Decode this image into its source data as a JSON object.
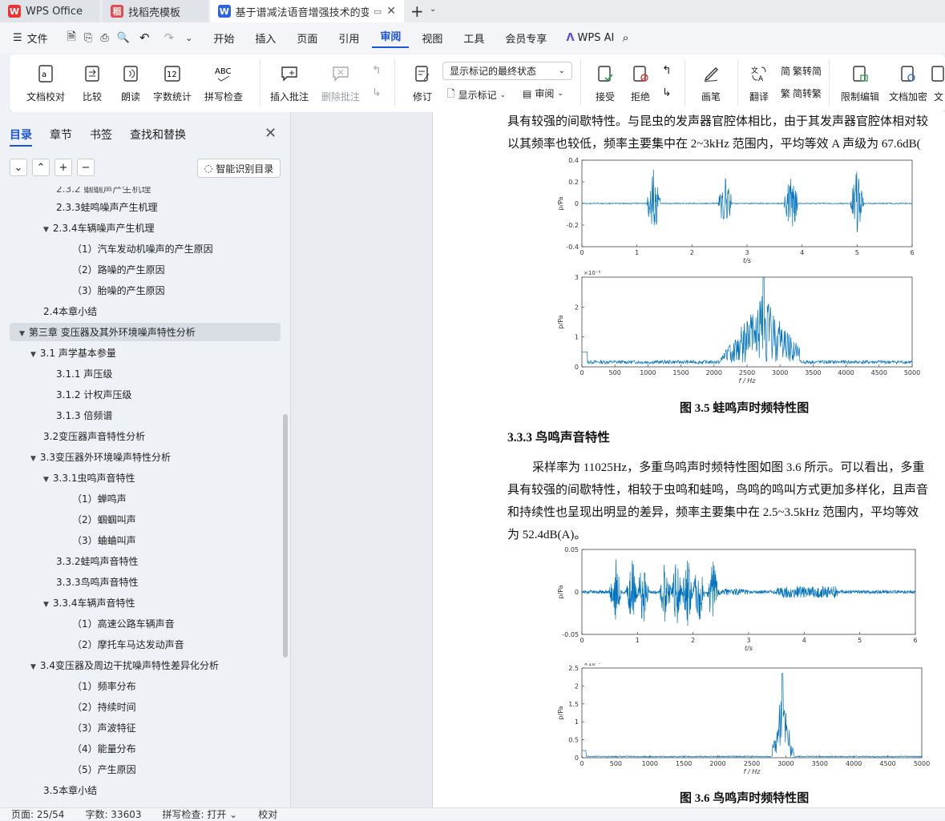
{
  "tabs": [
    {
      "label": "WPS Office",
      "icon": "wps-logo-icon"
    },
    {
      "label": "找稻壳模板",
      "icon": "docer-icon"
    },
    {
      "label": "基于谱减法语音增强技术的变压",
      "icon": "word-doc-icon"
    }
  ],
  "menu": {
    "file": "文件",
    "items": [
      "开始",
      "插入",
      "页面",
      "引用",
      "审阅",
      "视图",
      "工具",
      "会员专享"
    ],
    "active": "审阅",
    "ai": "WPS AI"
  },
  "ribbon": {
    "buttons": [
      "文档校对",
      "比较",
      "朗读",
      "字数统计",
      "拼写检查",
      "插入批注",
      "删除批注",
      "修订",
      "显示标记",
      "审阅",
      "接受",
      "拒绝",
      "画笔",
      "翻译",
      "繁转简",
      "简转繁",
      "限制编辑",
      "文档加密",
      "文"
    ],
    "markup_select": "显示标记的最终状态"
  },
  "sidebar": {
    "tabs": [
      "目录",
      "章节",
      "书签",
      "查找和替换"
    ],
    "smart_button": "智能识别目录",
    "toc": [
      {
        "text": "2.3.3蛙鸣噪声产生机理",
        "level": 2,
        "caret": false
      },
      {
        "text": "2.3.4车辆噪声产生机理",
        "level": 2,
        "caret": true
      },
      {
        "text": "（1）汽车发动机噪声的产生原因",
        "level": 3,
        "caret": false
      },
      {
        "text": "（2）路噪的产生原因",
        "level": 3,
        "caret": false
      },
      {
        "text": "（3）胎噪的产生原因",
        "level": 3,
        "caret": false
      },
      {
        "text": "2.4本章小结",
        "level": 1,
        "caret": false
      },
      {
        "text": "第三章  变压器及其外环境噪声特性分析",
        "level": 0,
        "caret": true,
        "highlight": true
      },
      {
        "text": "3.1  声学基本参量",
        "level": 1,
        "caret": true
      },
      {
        "text": "3.1.1  声压级",
        "level": 2,
        "caret": false
      },
      {
        "text": "3.1.2  计权声压级",
        "level": 2,
        "caret": false
      },
      {
        "text": "3.1.3  倍频谱",
        "level": 2,
        "caret": false
      },
      {
        "text": "3.2变压器声音特性分析",
        "level": 1,
        "caret": false
      },
      {
        "text": "3.3变压器外环境噪声特性分析",
        "level": 1,
        "caret": true
      },
      {
        "text": "3.3.1虫鸣声音特性",
        "level": 2,
        "caret": true
      },
      {
        "text": "（1）蝉鸣声",
        "level": 3,
        "caret": false
      },
      {
        "text": "（2）蝈蝈叫声",
        "level": 3,
        "caret": false
      },
      {
        "text": "（3）蛐蛐叫声",
        "level": 3,
        "caret": false
      },
      {
        "text": "3.3.2蛙鸣声音特性",
        "level": 2,
        "caret": false
      },
      {
        "text": "3.3.3鸟鸣声音特性",
        "level": 2,
        "caret": false
      },
      {
        "text": "3.3.4车辆声音特性",
        "level": 2,
        "caret": true
      },
      {
        "text": "（1）高速公路车辆声音",
        "level": 3,
        "caret": false
      },
      {
        "text": "（2）摩托车马达发动声音",
        "level": 3,
        "caret": false
      },
      {
        "text": "3.4变压器及周边干扰噪声特性差异化分析",
        "level": 1,
        "caret": true
      },
      {
        "text": "（1）频率分布",
        "level": 3,
        "caret": false
      },
      {
        "text": "（2）持续时间",
        "level": 3,
        "caret": false
      },
      {
        "text": "（3）声波特征",
        "level": 3,
        "caret": false
      },
      {
        "text": "（4）能量分布",
        "level": 3,
        "caret": false
      },
      {
        "text": "（5）产生原因",
        "level": 3,
        "caret": false
      },
      {
        "text": "3.5本章小结",
        "level": 1,
        "caret": false
      }
    ]
  },
  "document": {
    "para_top_1": "具有较强的间歇特性。与昆虫的发声器官腔体相比，由于其发声器官腔体相对较",
    "para_top_2": "以其频率也较低，频率主要集中在 2~3kHz 范围内，平均等效 A 声级为 67.6dB(",
    "fig35_caption": "图 3.5  蛙鸣声时频特性图",
    "section_heading": "3.3.3  鸟鸣声音特性",
    "para_bird_1": "采样率为 11025Hz，多重鸟鸣声时频特性图如图 3.6 所示。可以看出，多重",
    "para_bird_2": "具有较强的间歇特性，相较于虫鸣和蛙鸣，鸟鸣的鸣叫方式更加多样化，且声音",
    "para_bird_3": "和持续性也呈现出明显的差异，频率主要集中在 2.5~3.5kHz 范围内，平均等效",
    "para_bird_4": "为 52.4dB(A)。",
    "fig36_caption": "图 3.6  鸟鸣声时频特性图"
  },
  "chart_data": [
    {
      "type": "line",
      "ylabel": "p/Pa",
      "xlabel": "t/s",
      "xlim": [
        0,
        6
      ],
      "ylim": [
        -0.4,
        0.4
      ],
      "xticks": [
        "0",
        "1",
        "2",
        "3",
        "4",
        "5",
        "6"
      ],
      "yticks": [
        "-0.4",
        "-0.2",
        "0",
        "0.2",
        "0.4"
      ],
      "bursts_at_s": [
        1.3,
        2.6,
        3.8,
        5.0
      ]
    },
    {
      "type": "line",
      "ylabel": "p/Pa",
      "xlabel": "f / Hz",
      "xlim": [
        0,
        5000
      ],
      "ylim": [
        0,
        3
      ],
      "exponent": "×10⁻⁵",
      "xticks": [
        "0",
        "500",
        "1000",
        "1500",
        "2000",
        "2500",
        "3000",
        "3500",
        "4000",
        "4500",
        "5000"
      ],
      "yticks": [
        "0",
        "1",
        "2",
        "3"
      ],
      "peak": {
        "x": 2750,
        "y": 3.0
      }
    },
    {
      "type": "line",
      "ylabel": "p/Pa",
      "xlabel": "t/s",
      "xlim": [
        0,
        6
      ],
      "ylim": [
        -0.05,
        0.05
      ],
      "xticks": [
        "0",
        "1",
        "2",
        "3",
        "4",
        "5",
        "6"
      ],
      "yticks": [
        "-0.05",
        "0",
        "0.05"
      ]
    },
    {
      "type": "line",
      "ylabel": "p/Pa",
      "xlabel": "f / Hz",
      "xlim": [
        0,
        5000
      ],
      "ylim": [
        0,
        2.5
      ],
      "exponent": "×10⁻³",
      "xticks": [
        "0",
        "500",
        "1000",
        "1500",
        "2000",
        "2500",
        "3000",
        "3500",
        "4000",
        "4500",
        "5000"
      ],
      "yticks": [
        "0",
        "0.5",
        "1",
        "1.5",
        "2",
        "2.5"
      ],
      "peak": {
        "x": 2950,
        "y": 2.35
      }
    }
  ],
  "status": {
    "page": "页面: 25/54",
    "words": "字数: 33603",
    "spell": "拼写检查: 打开 ⌄",
    "proof": "校对"
  }
}
